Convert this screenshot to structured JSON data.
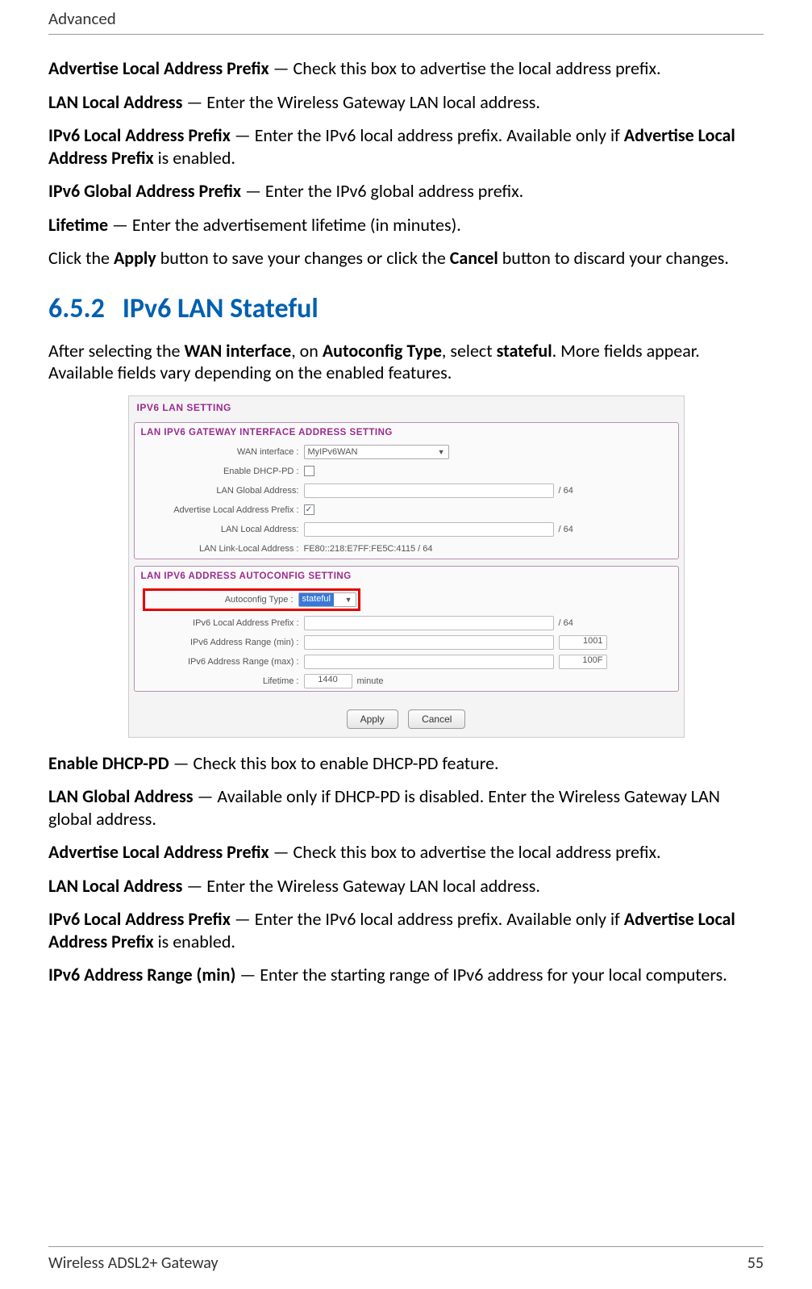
{
  "header": {
    "title": "Advanced"
  },
  "intro_paras": {
    "p1_bold": "Advertise Local Address Prefix",
    "p1_rest": " — Check this box to advertise the local address prefix.",
    "p2_bold": "LAN Local Address",
    "p2_rest": " — Enter the Wireless Gateway LAN local address.",
    "p3_bold": "IPv6 Local Address Prefix",
    "p3_mid": " — Enter the IPv6 local address prefix. Available only if ",
    "p3_bold2": "Advertise Local Address Prefix",
    "p3_rest": " is enabled.",
    "p4_bold": "IPv6 Global Address Prefix",
    "p4_rest": " — Enter the IPv6 global address prefix.",
    "p5_bold": "Lifetime",
    "p5_rest": " — Enter the advertisement lifetime (in minutes).",
    "p6_a": "Click the ",
    "p6_bold1": "Apply",
    "p6_b": " button to save your changes or click the ",
    "p6_bold2": "Cancel",
    "p6_c": " button to discard your changes."
  },
  "section": {
    "number": "6.5.2",
    "title": "IPv6 LAN Stateful",
    "lead_a": "After selecting the ",
    "lead_b1": "WAN interface",
    "lead_c": ", on ",
    "lead_b2": "Autoconfig Type",
    "lead_d": ", select ",
    "lead_b3": "stateful",
    "lead_e": ". More fields appear. Available fields vary depending on the enabled features."
  },
  "panel": {
    "top_title": "IPV6 LAN SETTING",
    "group1_title": "LAN IPV6 GATEWAY INTERFACE ADDRESS SETTING",
    "wan_label": "WAN interface :",
    "wan_value": "MyIPv6WAN",
    "enable_dhcp_label": "Enable DHCP-PD :",
    "lan_global_label": "LAN Global Address:",
    "lan_global_suffix": "/ 64",
    "adv_local_label": "Advertise Local Address Prefix :",
    "adv_local_checked": "✓",
    "lan_local_label": "LAN Local Address:",
    "lan_local_suffix": "/ 64",
    "lan_link_label": "LAN Link-Local Address :",
    "lan_link_value": "FE80::218:E7FF:FE5C:4115 / 64",
    "group2_title": "LAN IPV6 ADDRESS AUTOCONFIG SETTING",
    "autoconf_label": "Autoconfig Type :",
    "autoconf_value": "stateful",
    "ipv6_local_prefix_label": "IPv6 Local Address Prefix :",
    "ipv6_local_prefix_suffix": "/ 64",
    "range_min_label": "IPv6 Address Range (min) :",
    "range_min_value": "1001",
    "range_max_label": "IPv6 Address Range (max) :",
    "range_max_value": "100F",
    "lifetime_label": "Lifetime :",
    "lifetime_value": "1440",
    "lifetime_unit": "minute",
    "btn_apply": "Apply",
    "btn_cancel": "Cancel"
  },
  "after_paras": {
    "a1_bold": "Enable DHCP-PD",
    "a1_rest": " — Check this box to enable DHCP-PD feature.",
    "a2_bold": "LAN Global Address",
    "a2_rest": " — Available only if DHCP-PD is disabled. Enter the Wireless Gateway LAN global address.",
    "a3_bold": "Advertise Local Address Prefix",
    "a3_rest": " — Check this box to advertise the local address prefix.",
    "a4_bold": "LAN Local Address",
    "a4_rest": " — Enter the Wireless Gateway LAN local address.",
    "a5_bold": "IPv6 Local Address Prefix",
    "a5_mid": " — Enter the IPv6 local address prefix. Available only if ",
    "a5_bold2": "Advertise Local Address Prefix",
    "a5_rest": " is enabled.",
    "a6_bold": "IPv6 Address Range (min)",
    "a6_rest": " — Enter the starting range of IPv6 address for your local computers."
  },
  "footer": {
    "product": "Wireless ADSL2+ Gateway",
    "page": "55"
  }
}
